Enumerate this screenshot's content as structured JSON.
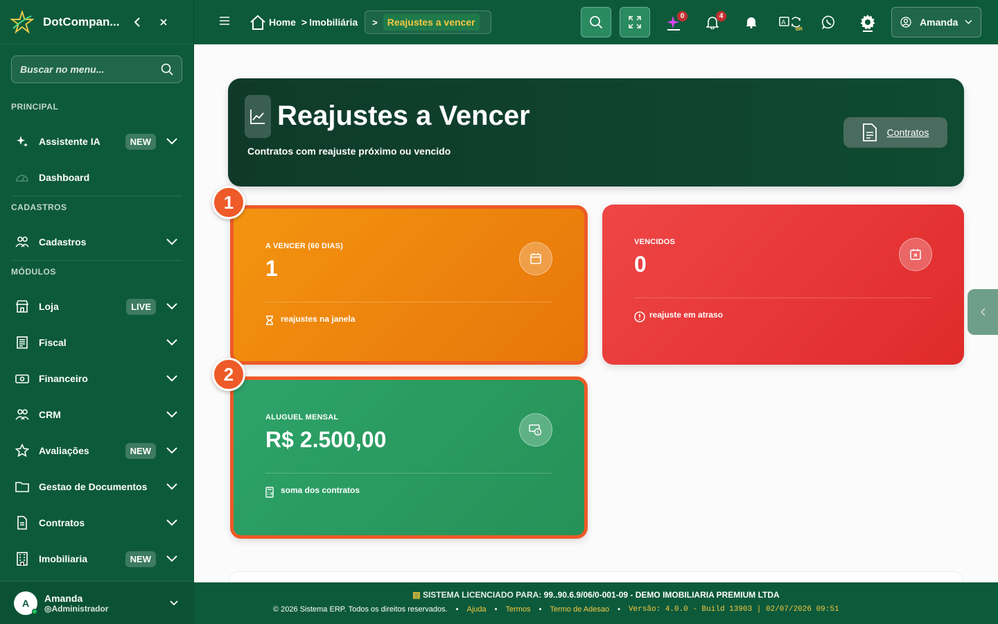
{
  "sidebar": {
    "brand": "DotCompan...",
    "search_placeholder": "Buscar no menu...",
    "sections": {
      "principal": "PRINCIPAL",
      "cadastros": "CADASTROS",
      "modulos": "MÓDULOS"
    },
    "items": {
      "assistente": {
        "label": "Assistente IA",
        "badge": "NEW"
      },
      "dashboard": {
        "label": "Dashboard"
      },
      "cadastros": {
        "label": "Cadastros"
      },
      "loja": {
        "label": "Loja",
        "badge": "LIVE"
      },
      "fiscal": {
        "label": "Fiscal"
      },
      "financeiro": {
        "label": "Financeiro"
      },
      "crm": {
        "label": "CRM"
      },
      "avaliacoes": {
        "label": "Avaliações",
        "badge": "NEW"
      },
      "documentos": {
        "label": "Gestao de Documentos"
      },
      "contratos": {
        "label": "Contratos"
      },
      "imobiliaria": {
        "label": "Imobiliaria",
        "badge": "NEW"
      }
    },
    "user": {
      "initial": "A",
      "name": "Amanda",
      "role": "Administrador"
    }
  },
  "topbar": {
    "breadcrumb": {
      "home": "Home",
      "section": "Imobiliária",
      "current": "Reajustes a vencer"
    },
    "notifications": {
      "ai_count": "0",
      "bell_count": "4"
    },
    "lang_tag": "BR",
    "user_name": "Amanda"
  },
  "hero": {
    "title": "Reajustes a Vencer",
    "subtitle": "Contratos com reajuste próximo ou vencido",
    "button_label": "Contratos"
  },
  "cards": {
    "a_vencer": {
      "title": "A VENCER (60 DIAS)",
      "value": "1",
      "footer": "reajustes na janela"
    },
    "vencidos": {
      "title": "VENCIDOS",
      "value": "0",
      "footer": "reajuste em atraso"
    },
    "aluguel": {
      "title": "ALUGUEL MENSAL",
      "value": "R$ 2.500,00",
      "footer": "soma dos contratos"
    }
  },
  "markers": {
    "m1": "1",
    "m2": "2"
  },
  "footer": {
    "license_prefix": "SISTEMA LICENCIADO PARA:",
    "license_value": "99..90.6.9/06/0-001-09 - DEMO IMOBILIARIA PREMIUM LTDA",
    "copyright": "© 2026 Sistema ERP. Todos os direitos reservados.",
    "links": {
      "ajuda": "Ajuda",
      "termos": "Termos",
      "adesao": "Termo de Adesao"
    },
    "version": "Versão: 4.0.0 - Build 13903 | 02/07/2026 09:51"
  },
  "colors": {
    "brand": "#0d5a3b",
    "orange": "#f39410",
    "red": "#ef4646",
    "green": "#2ea36a",
    "marker": "#ee5a28",
    "accent": "#f5c842"
  }
}
